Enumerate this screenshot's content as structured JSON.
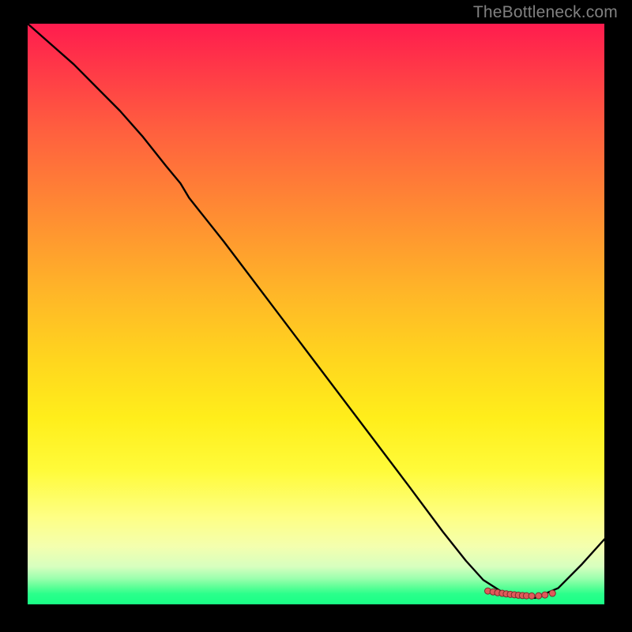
{
  "watermark": "TheBottleneck.com",
  "chart_data": {
    "type": "line",
    "title": "",
    "xlabel": "",
    "ylabel": "",
    "xlim": [
      0,
      100
    ],
    "ylim": [
      0,
      100
    ],
    "series": [
      {
        "name": "curve",
        "x": [
          0,
          4,
          8,
          12,
          16,
          20,
          24,
          26.5,
          28,
          34,
          42,
          50,
          58,
          66,
          72,
          76,
          79,
          82,
          85,
          88,
          92,
          96,
          100
        ],
        "values": [
          100,
          96.5,
          93,
          89,
          85,
          80.5,
          75.5,
          72.5,
          70,
          62.5,
          52,
          41.5,
          31,
          20.5,
          12.5,
          7.5,
          4.2,
          2.3,
          1.4,
          1.1,
          2.8,
          6.8,
          11.2
        ]
      }
    ],
    "markers": {
      "name": "bottom-cluster",
      "x": [
        79.8,
        80.7,
        81.5,
        82.3,
        83.0,
        83.7,
        84.4,
        85.1,
        85.8,
        86.5,
        87.4,
        88.6,
        89.7,
        91.0
      ],
      "values": [
        2.3,
        2.15,
        2.0,
        1.9,
        1.8,
        1.72,
        1.65,
        1.58,
        1.52,
        1.48,
        1.45,
        1.48,
        1.62,
        1.9
      ]
    }
  }
}
